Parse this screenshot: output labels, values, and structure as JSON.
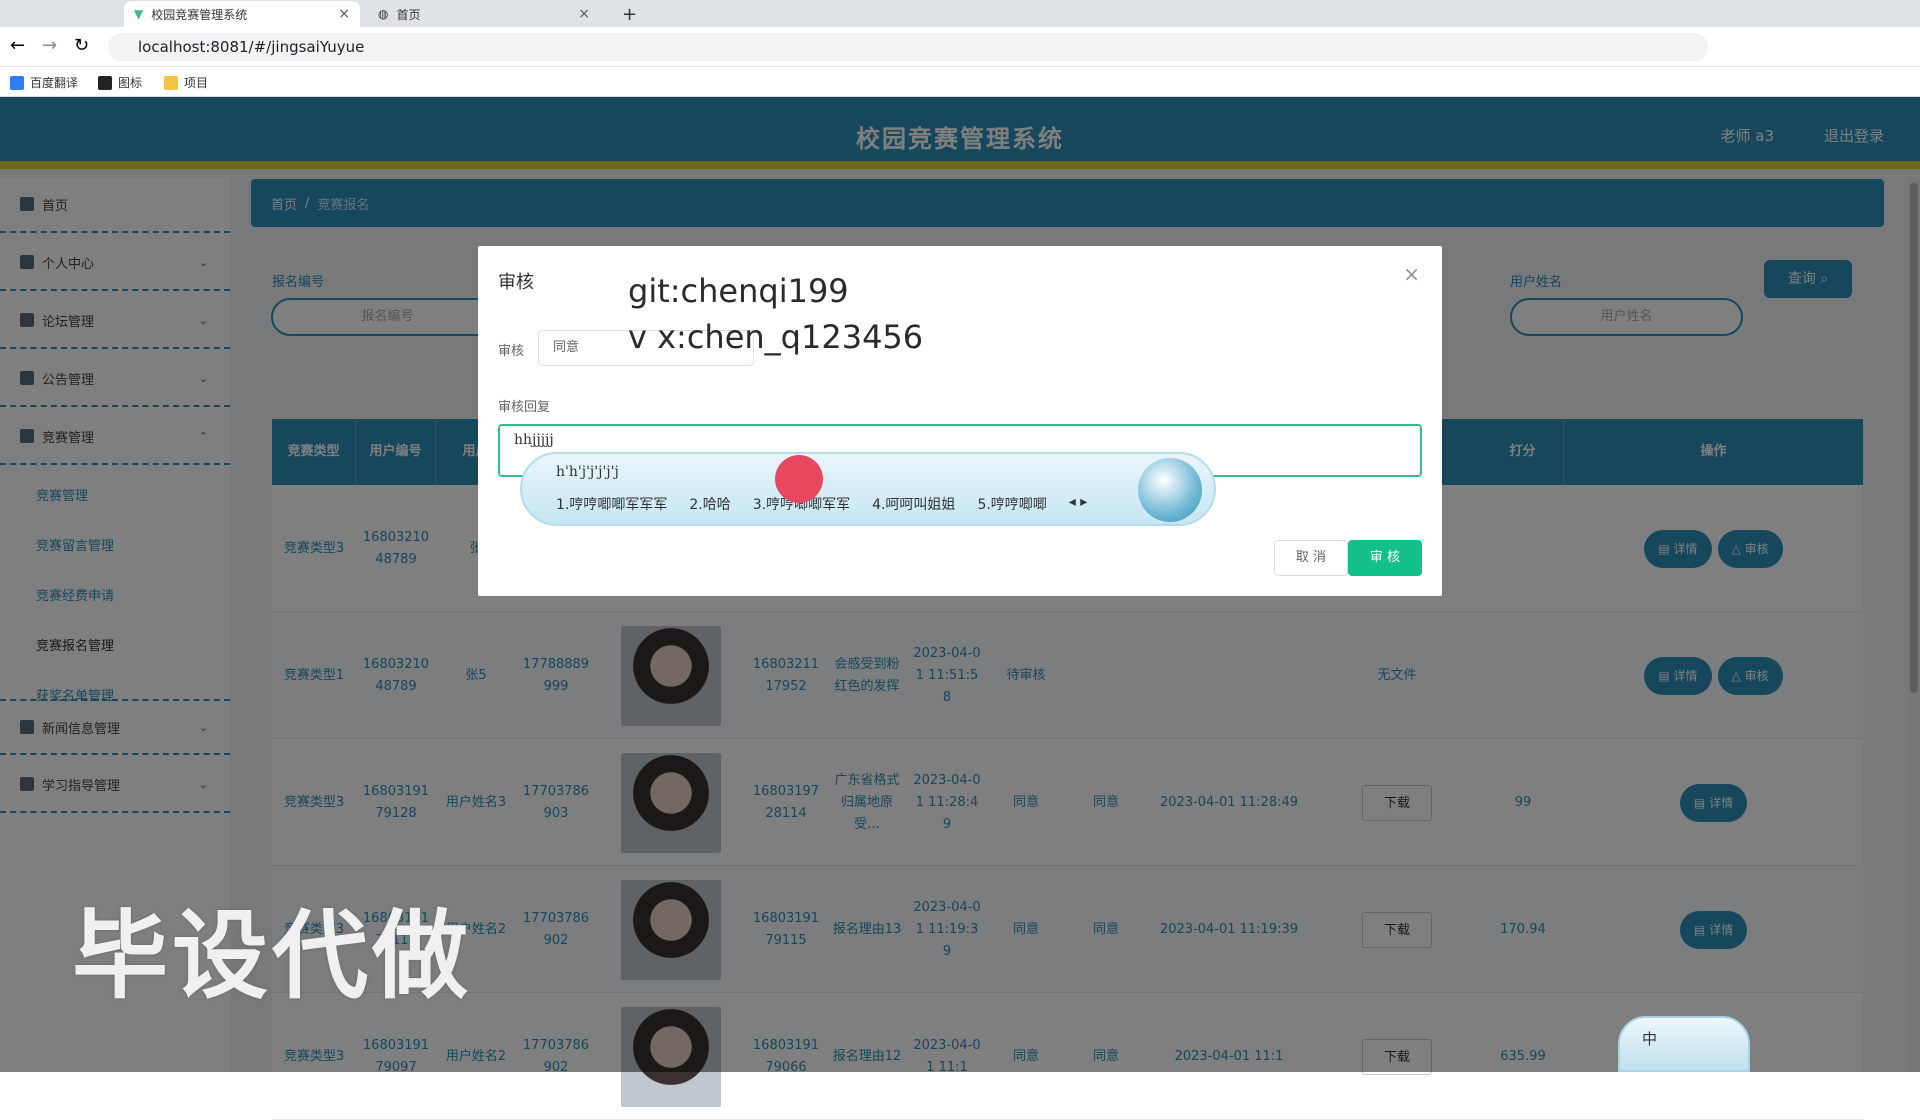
{
  "browser": {
    "tabs": [
      {
        "label": "校园竞赛管理系统",
        "active": true
      },
      {
        "label": "首页",
        "active": false
      }
    ],
    "url": "localhost:8081/#/jingsaiYuyue",
    "bookmarks": [
      "百度翻译",
      "图标",
      "项目"
    ]
  },
  "header": {
    "title": "校园竞赛管理系统",
    "user": "老师 a3",
    "logout": "退出登录"
  },
  "sidebar": {
    "items": [
      {
        "label": "首页"
      },
      {
        "label": "个人中心"
      },
      {
        "label": "论坛管理"
      },
      {
        "label": "公告管理"
      },
      {
        "label": "竞赛管理"
      },
      {
        "label": "新闻信息管理"
      },
      {
        "label": "学习指导管理"
      }
    ],
    "sub": [
      "竞赛管理",
      "竞赛留言管理",
      "竞赛经费申请",
      "竞赛报名管理",
      "获奖名单管理"
    ]
  },
  "breadcrumb": {
    "home": "首页",
    "sep": "/",
    "current": "竞赛报名"
  },
  "search": {
    "label1": "报名编号",
    "placeholder1": "报名编号",
    "label2": "用户姓名",
    "placeholder2": "用户姓名",
    "button": "查询"
  },
  "table": {
    "headers": [
      "竞赛类型",
      "用户编号",
      "用户",
      "打分",
      "操作"
    ],
    "rows": [
      {
        "type": "竞赛类型3",
        "uid": "1680321048789",
        "name": "张",
        "phone": "",
        "sid": "",
        "reason": "",
        "time": "",
        "status": "",
        "result": "",
        "rtime": "",
        "file": "",
        "score": "",
        "actions": [
          "详情",
          "审核"
        ]
      },
      {
        "type": "竞赛类型1",
        "uid": "1680321048789",
        "name": "张5",
        "phone": "17788889999",
        "sid": "1680321117952",
        "reason": "会感受到粉红色的发挥",
        "time": "2023-04-01 11:51:58",
        "status": "待审核",
        "result": "",
        "rtime": "",
        "file": "无文件",
        "score": "",
        "actions": [
          "详情",
          "审核"
        ]
      },
      {
        "type": "竞赛类型3",
        "uid": "1680319179128",
        "name": "用户姓名3",
        "phone": "17703786903",
        "sid": "1680319728114",
        "reason": "广东省格式归属地原受...",
        "time": "2023-04-01 11:28:49",
        "status": "同意",
        "result": "同意",
        "rtime": "2023-04-01 11:28:49",
        "file": "下载",
        "score": "99",
        "actions": [
          "详情"
        ]
      },
      {
        "type": "竞赛类型3",
        "uid": "1680319179115",
        "name": "用户姓名2",
        "phone": "17703786902",
        "sid": "1680319179115",
        "reason": "报名理由13",
        "time": "2023-04-01 11:19:39",
        "status": "同意",
        "result": "同意",
        "rtime": "2023-04-01 11:19:39",
        "file": "下载",
        "score": "170.94",
        "actions": [
          "详情"
        ]
      },
      {
        "type": "竞赛类型3",
        "uid": "1680319179097",
        "name": "用户姓名2",
        "phone": "17703786902",
        "sid": "1680319179066",
        "reason": "报名理由12",
        "time": "2023-04-01 11:1",
        "status": "同意",
        "result": "同意",
        "rtime": "2023-04-01 11:1",
        "file": "下载",
        "score": "635.99",
        "actions": []
      }
    ]
  },
  "modal": {
    "title": "审核",
    "close": "×",
    "audit_label": "审核",
    "audit_value": "同意",
    "reply_label": "审核回复",
    "reply_value": "hhjjjjj",
    "cancel": "取 消",
    "confirm": "审 核"
  },
  "watermark": {
    "line1": "git:chenqi199",
    "line2": "v x:chen_q123456",
    "big": "毕设代做"
  },
  "ime": {
    "composition": "h'h'j'j'j'j'j",
    "candidates": [
      "1.哼哼唧唧军军军",
      "2.哈哈",
      "3.哼哼唧唧军军",
      "4.呵呵叫姐姐",
      "5.哼哼唧唧"
    ],
    "mini": "中"
  }
}
